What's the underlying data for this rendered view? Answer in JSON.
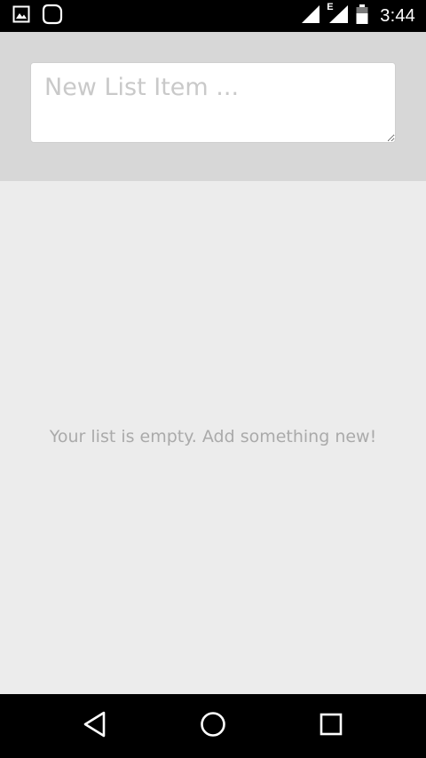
{
  "status_bar": {
    "time": "3:44",
    "network_type": "E",
    "icons": [
      "image-notification-icon",
      "app-notification-icon",
      "signal-icon",
      "data-signal-icon",
      "battery-icon"
    ]
  },
  "input": {
    "placeholder": "New List Item ...",
    "value": ""
  },
  "list": {
    "empty_message": "Your list is empty. Add something new!"
  },
  "nav_bar": {
    "icons": [
      "back-icon",
      "home-icon",
      "recents-icon"
    ]
  }
}
